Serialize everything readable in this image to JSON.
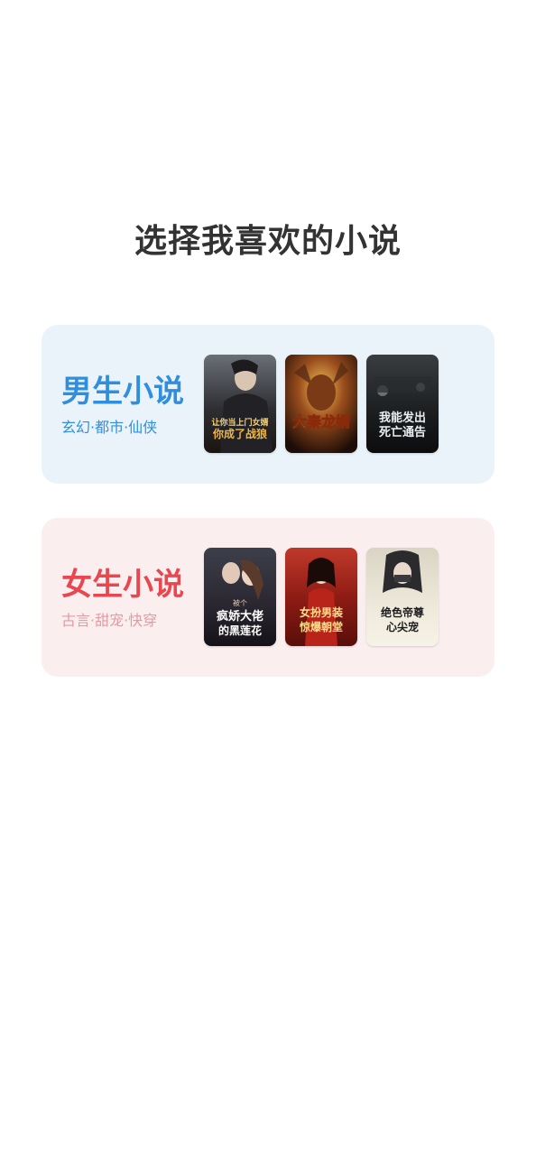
{
  "page": {
    "title": "选择我喜欢的小说"
  },
  "categories": [
    {
      "title": "男生小说",
      "subtitle": "玄幻·都市·仙侠",
      "title_color": "#2f8fde",
      "subtitle_color": "#2f8fde",
      "covers": [
        {
          "lines": [
            "让你当上门女婿",
            "你成了战狼"
          ]
        },
        {
          "lines": [
            "大秦龙婿"
          ]
        },
        {
          "lines": [
            "我能发出",
            "死亡通告"
          ]
        }
      ]
    },
    {
      "title": "女生小说",
      "subtitle": "古言·甜宠·快穿",
      "title_color": "#e8474f",
      "subtitle_color": "#e39aa3",
      "covers": [
        {
          "lines": [
            "被个",
            "疯娇大佬",
            "的黑莲花"
          ]
        },
        {
          "lines": [
            "女扮男装",
            "惊爆朝堂"
          ]
        },
        {
          "lines": [
            "绝色帝尊",
            "心尖宠"
          ]
        }
      ]
    }
  ]
}
